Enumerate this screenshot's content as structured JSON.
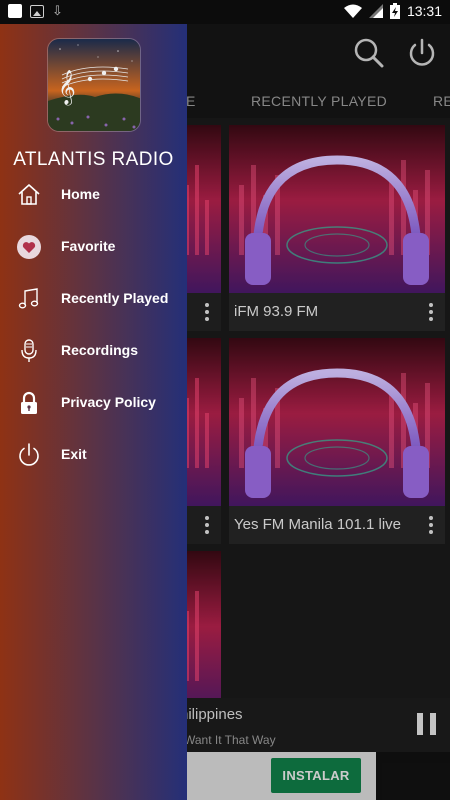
{
  "status_bar": {
    "time": "13:31"
  },
  "background": {
    "tabs": [
      "E",
      "RECENTLY PLAYED",
      "RE"
    ],
    "cards": [
      {
        "title": "iFM 93.9 FM"
      },
      {
        "title": "Yes FM Manila 101.1 live"
      }
    ],
    "player": {
      "title": "hilippines",
      "subtitle": "Want It That Way"
    },
    "ad": {
      "install_label": "INSTALAR"
    }
  },
  "drawer": {
    "app_name": "ATLANTIS RADIO",
    "items": [
      {
        "label": "Home",
        "icon": "home-icon"
      },
      {
        "label": "Favorite",
        "icon": "heart-icon"
      },
      {
        "label": "Recently Played",
        "icon": "music-note-icon"
      },
      {
        "label": "Recordings",
        "icon": "microphone-icon"
      },
      {
        "label": "Privacy Policy",
        "icon": "lock-icon"
      },
      {
        "label": "Exit",
        "icon": "power-icon"
      }
    ]
  },
  "colors": {
    "drawer_gradient_start": "#8f3214",
    "drawer_gradient_end": "#242f78",
    "install_button": "#0f7a46"
  }
}
